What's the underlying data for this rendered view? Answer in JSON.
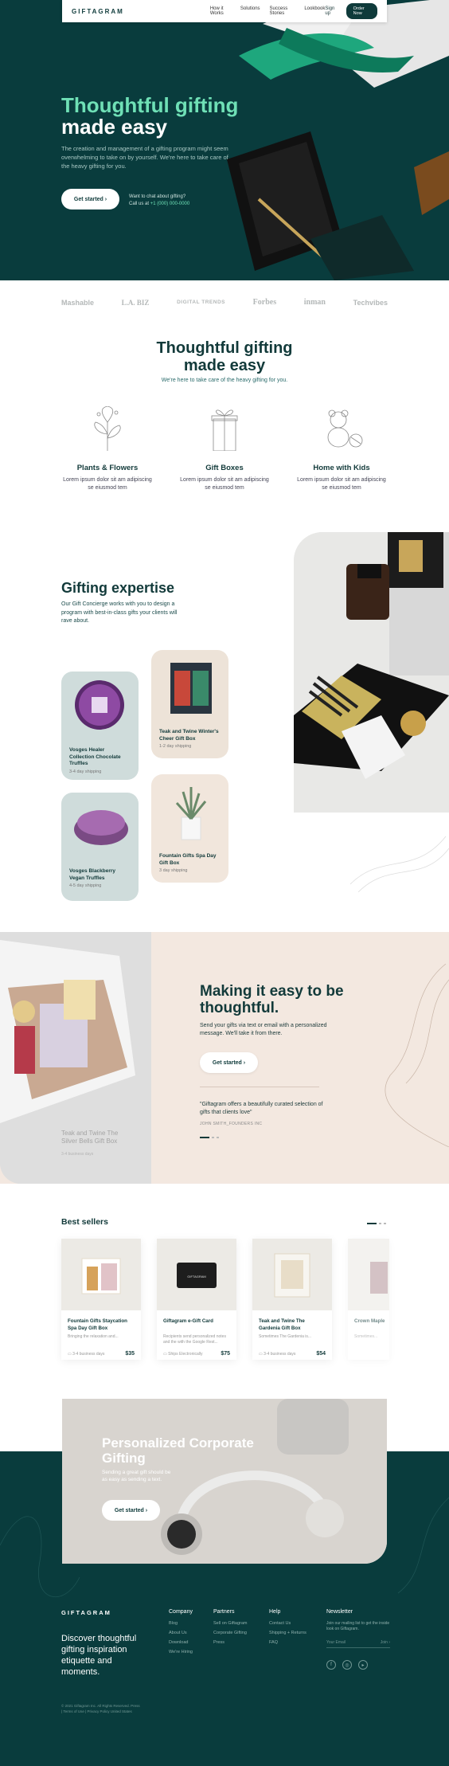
{
  "nav": {
    "logo": "GIFTAGRAM",
    "links": [
      "How it Works",
      "Solutions",
      "Success Stories",
      "Lookbook"
    ],
    "signup": "Sign up",
    "order": "Order Now"
  },
  "hero": {
    "title_accent": "Thoughtful gifting",
    "title_rest": "made easy",
    "subtitle": "The creation and management of a gifting program might seem overwhelming to take on by yourself. We're here to take care of the heavy gifting for you.",
    "cta": "Get started",
    "chat_line1": "Want to chat about gifting?",
    "chat_line2_prefix": "Call us at",
    "phone": "+1 (000) 000-0000"
  },
  "press": [
    "Mashable",
    "L.A. BIZ",
    "DIGITAL TRENDS",
    "Forbes",
    "inman",
    "Techvibes"
  ],
  "thoughtful": {
    "title": "Thoughtful gifting made easy",
    "subtitle": "We're here to take care of the heavy gifting for you.",
    "categories": [
      {
        "name": "Plants & Flowers",
        "desc": "Lorem ipsum dolor sit am adipiscing se eiusmod tem",
        "icon": "flower-icon"
      },
      {
        "name": "Gift Boxes",
        "desc": "Lorem ipsum dolor sit am adipiscing se eiusmod tem",
        "icon": "gift-box-icon"
      },
      {
        "name": "Home with Kids",
        "desc": "Lorem ipsum dolor sit am adipiscing se eiusmod tem",
        "icon": "teddy-bear-icon"
      }
    ]
  },
  "expertise": {
    "title": "Gifting expertise",
    "text": "Our Gift Concierge works with you to design a program with best-in-class gifts your clients will rave about.",
    "cards": [
      {
        "name": "Vosges Healer Collection Chocolate Truffles",
        "shipping": "3-4 day shipping"
      },
      {
        "name": "Vosges Blackberry Vegan Truffles",
        "shipping": "4-5 day shipping"
      },
      {
        "name": "Teak and Twine Winter's Cheer Gift Box",
        "shipping": "1-2 day shipping"
      },
      {
        "name": "Fountain Gifts Spa Day Gift Box",
        "shipping": "3 day shipping"
      }
    ]
  },
  "easy": {
    "title": "Making it easy to be thoughtful.",
    "text": "Send your gifts via text or email with a personalized message. We'll take it from there.",
    "cta": "Get started",
    "quote": "\"Giftagram offers a beautifully curated selection of gifts that clients love\"",
    "author": "JOHN SMITH_FOUNDERS INC",
    "photo_caption": "Teak and Twine The Silver Bells Gift Box",
    "photo_shipping": "3-4 business days"
  },
  "bestsellers": {
    "title": "Best sellers",
    "products": [
      {
        "name": "Fountain Gifts Staycation Spa Day Gift Box",
        "desc": "Bringing the relaxation and...",
        "ship": "3-4 business days",
        "price": "$35"
      },
      {
        "name": "Giftagram e-Gift Card",
        "desc": "Recipients send personalized notes and the with the Google Rest...",
        "ship": "Ships Electronically",
        "price": "$75"
      },
      {
        "name": "Teak and Twine The Gardenia Gift Box",
        "desc": "Sometimes The Gardenia is...",
        "ship": "3-4 business days",
        "price": "$54"
      },
      {
        "name": "Crown Maple",
        "desc": "Sometimes...",
        "ship": "",
        "price": ""
      }
    ]
  },
  "corporate": {
    "title": "Personalized Corporate Gifting",
    "text": "Sending a great gift should be as easy as sending a text.",
    "cta": "Get started"
  },
  "footer": {
    "logo": "GIFTAGRAM",
    "tagline": "Discover thoughtful gifting inspiration etiquette and moments.",
    "columns": [
      {
        "title": "Company",
        "links": [
          "Blog",
          "About Us",
          "Download",
          "We're Hiring"
        ]
      },
      {
        "title": "Partners",
        "links": [
          "Sell on Giftagram",
          "Corporate Gifting",
          "Press"
        ]
      },
      {
        "title": "Help",
        "links": [
          "Contact Us",
          "Shipping + Returns",
          "FAQ"
        ]
      }
    ],
    "newsletter": {
      "title": "Newsletter",
      "text": "Join our mailing list to get the inside look on Giftagram.",
      "placeholder": "Your Email",
      "join": "Join"
    },
    "legal": "© 2021 Giftagram Inc. All Rights Reserved. Press | Terms of Use | Privacy Policy United States"
  },
  "colors": {
    "primary": "#093c3d",
    "accent": "#6fe0b6",
    "cream": "#f3e8e0"
  }
}
